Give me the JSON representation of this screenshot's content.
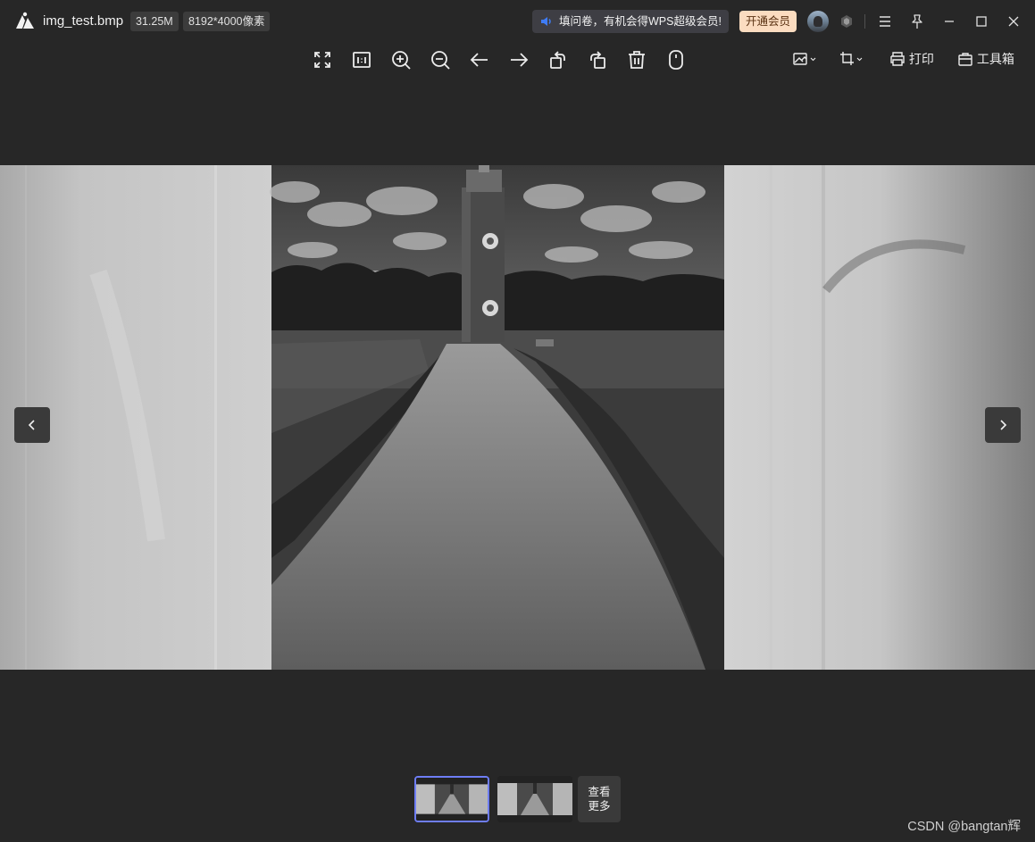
{
  "titlebar": {
    "filename": "img_test.bmp",
    "file_size": "31.25M",
    "dimensions": "8192*4000像素",
    "promo_text": "填问卷，有机会得WPS超级会员!",
    "vip_button": "开通会员"
  },
  "toolbar": {
    "tools": [
      "fullscreen-icon",
      "actual-size-icon",
      "zoom-in-icon",
      "zoom-out-icon",
      "previous-arrow-icon",
      "next-arrow-icon",
      "rotate-left-icon",
      "rotate-right-icon",
      "delete-icon",
      "mouse-icon"
    ],
    "print_label": "打印",
    "toolbox_label": "工具箱"
  },
  "thumbnails": {
    "more_label_line1": "查看",
    "more_label_line2": "更多"
  },
  "watermark": "CSDN @bangtan辉",
  "colors": {
    "background": "#272727",
    "vip_bg": "#fbdcc0",
    "active_thumb_border": "#6e7df5",
    "promo_icon": "#3f7cf5"
  }
}
